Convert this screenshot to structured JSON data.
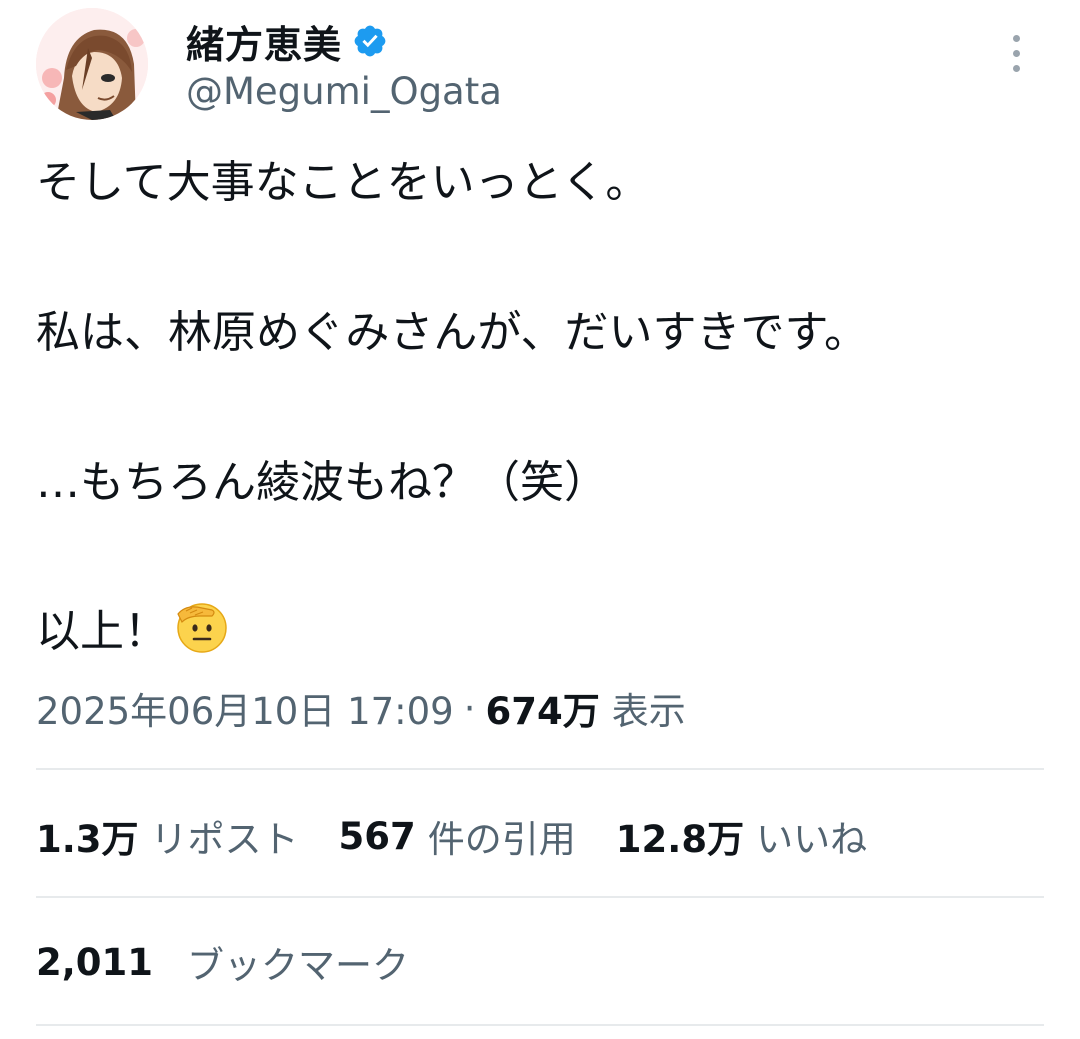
{
  "author": {
    "display_name": "緒方恵美",
    "handle": "@Megumi_Ogata",
    "verified_icon": "verified-badge-icon",
    "avatar": "avatar-illustration"
  },
  "tweet": {
    "lines": [
      "そして大事なことをいっとく。",
      "私は、林原めぐみさんが、だいすきです。",
      "…もちろん綾波もね？（笑）",
      "以上！"
    ],
    "emoji": "saluting-face-emoji"
  },
  "meta": {
    "timestamp": "2025年06月10日 17:09",
    "separator": "·",
    "views_count": "674万",
    "views_label": "表示"
  },
  "stats": {
    "reposts_count": "1.3万",
    "reposts_label": "リポスト",
    "quotes_count": "567",
    "quotes_label": "件の引用",
    "likes_count": "12.8万",
    "likes_label": "いいね",
    "bookmarks_count": "2,011",
    "bookmarks_label": "ブックマーク"
  },
  "colors": {
    "text_primary": "#0f1419",
    "text_secondary": "#536471",
    "verified_blue": "#1d9bf0",
    "divider": "#e7eaec"
  }
}
